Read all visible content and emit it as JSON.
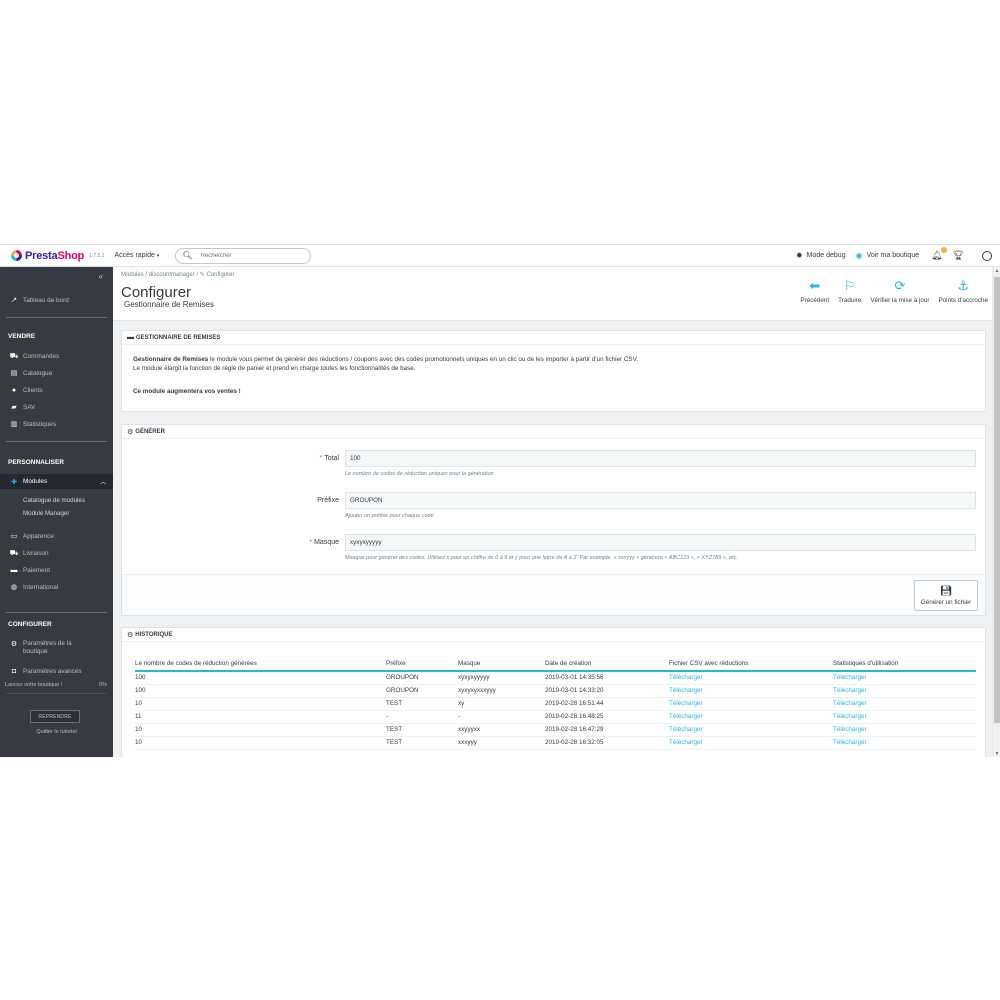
{
  "header": {
    "logo_main": "Presta",
    "logo_accent": "Shop",
    "version": "1.7.5.1",
    "quick_access": "Accès rapide",
    "search_placeholder": "Rechercher",
    "debug_mode": "Mode debug",
    "view_shop": "Voir ma boutique",
    "icons": [
      "bug-icon",
      "eye-icon",
      "bell-icon",
      "trophy-icon",
      "user-icon"
    ]
  },
  "sidebar": {
    "dashboard": "Tableau de bord",
    "sections": {
      "sell": "VENDRE",
      "customize": "PERSONNALISER",
      "configure": "CONFIGURER"
    },
    "sell_items": [
      "Commandes",
      "Catalogue",
      "Clients",
      "SAV",
      "Statistiques"
    ],
    "modules": "Modules",
    "module_sub": [
      "Catalogue de modules",
      "Module Manager"
    ],
    "customize_items": [
      "Apparence",
      "Livraison",
      "Paiement",
      "International"
    ],
    "configure_items": [
      "Paramètres de la boutique",
      "Paramètres avancés"
    ],
    "onboarding": {
      "label": "Lancez votre boutique !",
      "percent": "0%",
      "resume": "REPRENDRE",
      "quit": "Quitter le tutoriel"
    }
  },
  "page": {
    "breadcrumb": [
      "Modules",
      "discountmanager",
      "Configurer"
    ],
    "title": "Configurer",
    "subtitle": "Gestionnaire de Remises",
    "toolbar": [
      {
        "label": "Précédent",
        "icon": "back-icon"
      },
      {
        "label": "Traduire",
        "icon": "flag-icon"
      },
      {
        "label": "Vérifier la mise à jour",
        "icon": "refresh-icon"
      },
      {
        "label": "Points d'accroche",
        "icon": "anchor-icon"
      }
    ]
  },
  "intro_panel": {
    "title": "GESTIONNAIRE DE REMISES",
    "line1_bold": "Gestionnaire de Remises",
    "line1_rest": " le module vous permet de générer des réductions / coupons avec des codes promotionnels uniques en un clic ou de les importer à partir d'un fichier CSV.",
    "line2": "Le module élargit la fonction de règle de panier et prend en charge toutes les fonctionnalités de base.",
    "line3": "Ce module augmentera vos ventes !"
  },
  "generate_panel": {
    "title": "GÉNÉRER",
    "total": {
      "label": "Total",
      "value": "100",
      "help": "Le nombre de codes de réduction uniques pour la génération"
    },
    "prefix": {
      "label": "Préfixe",
      "value": "GROUPON",
      "help": "Ajouter un préfixe pour chaque code"
    },
    "mask": {
      "label": "Masque",
      "value": "xyxyxyyyyy",
      "help": "Masque pour générer des codes. Utilisez x pour un chiffre de 0 à 9 et y pour une lettre de A à Z. Par exemple, « xxxyyy » générera « ABC123 », « XYZ789 », etc."
    },
    "button": "Générer un fichier"
  },
  "history_panel": {
    "title": "HISTORIQUE",
    "columns": [
      "Le nombre de codes de réduction générées",
      "Préfixe",
      "Masque",
      "Date de création",
      "Fichier CSV avec réductions",
      "Statistiques d'utilisation"
    ],
    "rows": [
      [
        "100",
        "GROUPON",
        "xyxyxyyyyy",
        "2019-03-01 14:35:56",
        "Télécharger",
        "Télécharger"
      ],
      [
        "100",
        "GROUPON",
        "xyxyxyxxxyyy",
        "2019-03-01 14:33:20",
        "Télécharger",
        "Télécharger"
      ],
      [
        "10",
        "TEST",
        "xy",
        "2019-02-28 16:51:44",
        "Télécharger",
        "Télécharger"
      ],
      [
        "11",
        "-",
        "-",
        "2019-02-28 16:48:25",
        "Télécharger",
        "Télécharger"
      ],
      [
        "10",
        "TEST",
        "xxyyyxx",
        "2019-02-28 16:47:29",
        "Télécharger",
        "Télécharger"
      ],
      [
        "10",
        "TEST",
        "xxxyyy",
        "2019-02-28 16:32:05",
        "Télécharger",
        "Télécharger"
      ]
    ]
  }
}
